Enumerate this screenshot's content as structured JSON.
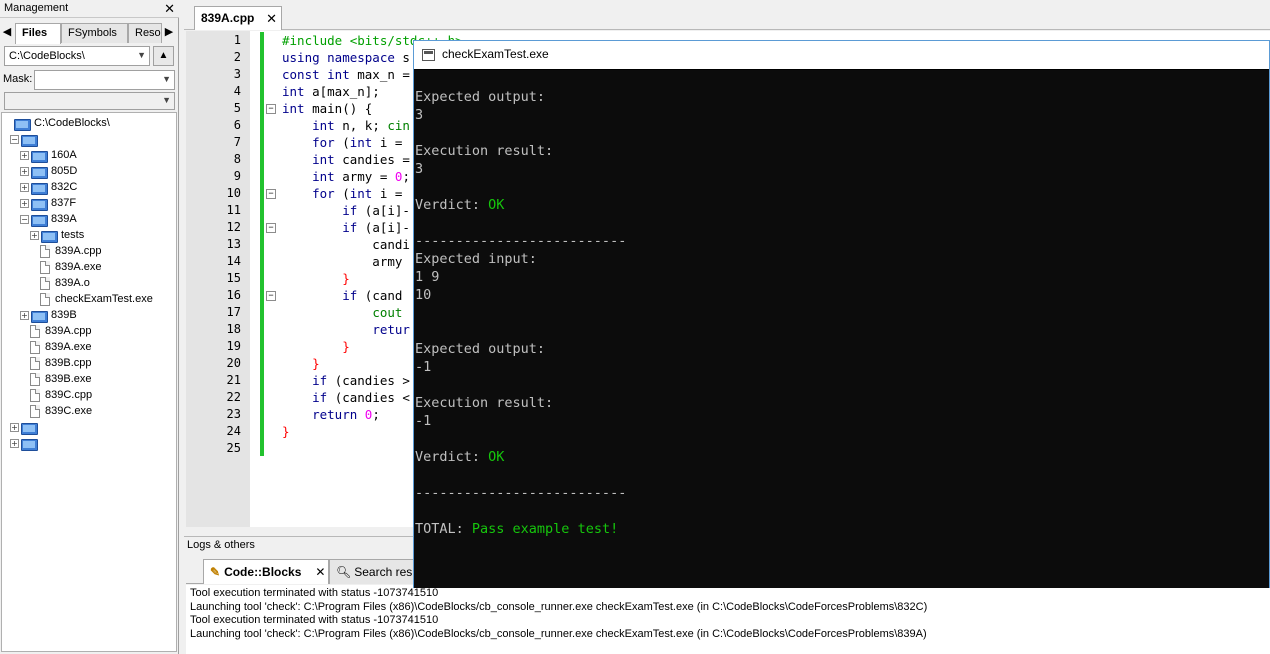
{
  "management": {
    "title": "Management",
    "tabs": [
      "Files",
      "FSymbols",
      "Reso"
    ],
    "directory": "C:\\CodeBlocks\\",
    "mask_label": "Mask:",
    "mask_value": "",
    "tree": [
      {
        "label": "C:\\CodeBlocks\\",
        "type": "folder-root"
      },
      {
        "label": "",
        "type": "folder",
        "expander": "−"
      },
      {
        "label": "160A",
        "type": "folder",
        "expander": "+"
      },
      {
        "label": "805D",
        "type": "folder",
        "expander": "+"
      },
      {
        "label": "832C",
        "type": "folder",
        "expander": "+"
      },
      {
        "label": "837F",
        "type": "folder",
        "expander": "+"
      },
      {
        "label": "839A",
        "type": "folder",
        "expander": "−"
      },
      {
        "label": "tests",
        "type": "folder",
        "expander": "+"
      },
      {
        "label": "839A.cpp",
        "type": "file"
      },
      {
        "label": "839A.exe",
        "type": "file"
      },
      {
        "label": "839A.o",
        "type": "file"
      },
      {
        "label": "checkExamTest.exe",
        "type": "file"
      },
      {
        "label": "839B",
        "type": "folder",
        "expander": "+"
      },
      {
        "label": "839A.cpp",
        "type": "file"
      },
      {
        "label": "839A.exe",
        "type": "file"
      },
      {
        "label": "839B.cpp",
        "type": "file"
      },
      {
        "label": "839B.exe",
        "type": "file"
      },
      {
        "label": "839C.cpp",
        "type": "file"
      },
      {
        "label": "839C.exe",
        "type": "file"
      },
      {
        "label": "",
        "type": "folder",
        "expander": "+"
      },
      {
        "label": "",
        "type": "folder",
        "expander": "+"
      }
    ]
  },
  "editor": {
    "tab_label": "839A.cpp",
    "lines": [
      {
        "n": "1",
        "html": "<span class='pp'>#include &lt;bits/stdc++.h&gt;</span>"
      },
      {
        "n": "2",
        "html": "<span class='kw'>using namespace</span> s"
      },
      {
        "n": "3",
        "html": "<span class='kw'>const int</span> max_n ="
      },
      {
        "n": "4",
        "html": "<span class='kw'>int</span> a[max_n];"
      },
      {
        "n": "5",
        "html": "<span class='kw'>int</span> main() {"
      },
      {
        "n": "6",
        "html": "    <span class='kw'>int</span> n, k; <span class='grn'>cin</span>"
      },
      {
        "n": "7",
        "html": "    <span class='kw'>for</span> (<span class='kw'>int</span> i ="
      },
      {
        "n": "8",
        "html": "    <span class='kw'>int</span> candies ="
      },
      {
        "n": "9",
        "html": "    <span class='kw'>int</span> army = <span class='num'>0</span>;"
      },
      {
        "n": "10",
        "html": "    <span class='kw'>for</span> (<span class='kw'>int</span> i ="
      },
      {
        "n": "11",
        "html": "        <span class='kw'>if</span> (a[i]-"
      },
      {
        "n": "12",
        "html": "        <span class='kw'>if</span> (a[i]-"
      },
      {
        "n": "13",
        "html": "            candi"
      },
      {
        "n": "14",
        "html": "            army"
      },
      {
        "n": "15",
        "html": "        <span class='op'>}</span>"
      },
      {
        "n": "16",
        "html": "        <span class='kw'>if</span> (cand"
      },
      {
        "n": "17",
        "html": "            <span class='grn'>cout</span>"
      },
      {
        "n": "18",
        "html": "            <span class='kw'>retur</span>"
      },
      {
        "n": "19",
        "html": "        <span class='op'>}</span>"
      },
      {
        "n": "20",
        "html": "    <span class='op'>}</span>"
      },
      {
        "n": "21",
        "html": "    <span class='kw'>if</span> (candies &gt;"
      },
      {
        "n": "22",
        "html": "    <span class='kw'>if</span> (candies &lt;"
      },
      {
        "n": "23",
        "html": "    <span class='kw'>return</span> <span class='num'>0</span>;"
      },
      {
        "n": "24",
        "html": "<span class='op'>}</span>"
      },
      {
        "n": "25",
        "html": ""
      }
    ]
  },
  "logs": {
    "header": "Logs & others",
    "tabs": [
      "Code::Blocks",
      "Search resul"
    ],
    "lines": [
      "Tool execution terminated with status -1073741510",
      "Launching tool 'check': C:\\Program Files (x86)\\CodeBlocks/cb_console_runner.exe checkExamTest.exe  (in C:\\CodeBlocks\\CodeForcesProblems\\832C)",
      "Tool execution terminated with status -1073741510",
      "Launching tool 'check': C:\\Program Files (x86)\\CodeBlocks/cb_console_runner.exe checkExamTest.exe  (in C:\\CodeBlocks\\CodeForcesProblems\\839A)"
    ]
  },
  "console": {
    "title": "checkExamTest.exe",
    "lines": [
      {
        "text": "Expected output:"
      },
      {
        "text": "3"
      },
      {
        "text": ""
      },
      {
        "text": "Execution result:"
      },
      {
        "text": "3"
      },
      {
        "text": ""
      },
      {
        "text": "Verdict: ",
        "ok": "OK"
      },
      {
        "text": ""
      },
      {
        "text": "--------------------------"
      },
      {
        "text": "Expected input:"
      },
      {
        "text": "1 9"
      },
      {
        "text": "10"
      },
      {
        "text": ""
      },
      {
        "text": ""
      },
      {
        "text": "Expected output:"
      },
      {
        "text": "-1"
      },
      {
        "text": ""
      },
      {
        "text": "Execution result:"
      },
      {
        "text": "-1"
      },
      {
        "text": ""
      },
      {
        "text": "Verdict: ",
        "ok": "OK"
      },
      {
        "text": ""
      },
      {
        "text": "--------------------------"
      },
      {
        "text": ""
      },
      {
        "text": "TOTAL: ",
        "ok": "Pass example test!"
      }
    ]
  },
  "colors": {
    "console_ok": "#16c60c",
    "change_bar": "#22c22e",
    "console_border": "#5b9bd5"
  }
}
